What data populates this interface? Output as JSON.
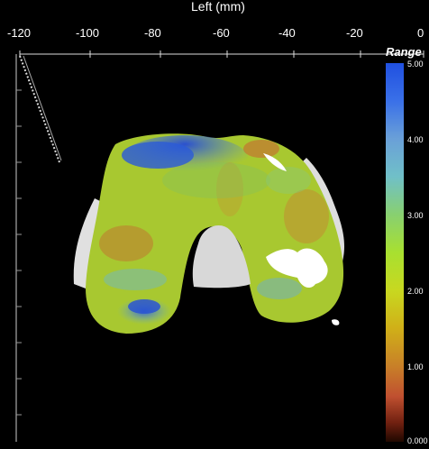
{
  "axis": {
    "title": "Left (mm)",
    "ticks": [
      "-120",
      "-100",
      "-80",
      "-60",
      "-40",
      "-20",
      "0"
    ]
  },
  "colorbar": {
    "title": "Range",
    "labels": [
      "5.00",
      "4.00",
      "3.00",
      "2.00",
      "1.00",
      "0.000"
    ],
    "range": [
      0.0,
      5.0
    ],
    "colors": [
      "#2050e0",
      "#3a70e8",
      "#5a90d8",
      "#70b0d0",
      "#70c8b8",
      "#80d090",
      "#a0dc60",
      "#b8e030",
      "#c8d820",
      "#d0c818",
      "#d0a020",
      "#c87828",
      "#c05030",
      "#902818",
      "#501008",
      "#200800"
    ]
  },
  "scene": {
    "description_colors": {
      "femur_surface_base": "#a8c830",
      "high_region": "#2a5fd0",
      "bone_gray": "#e8e8e8",
      "low_region": "#c07830"
    }
  }
}
